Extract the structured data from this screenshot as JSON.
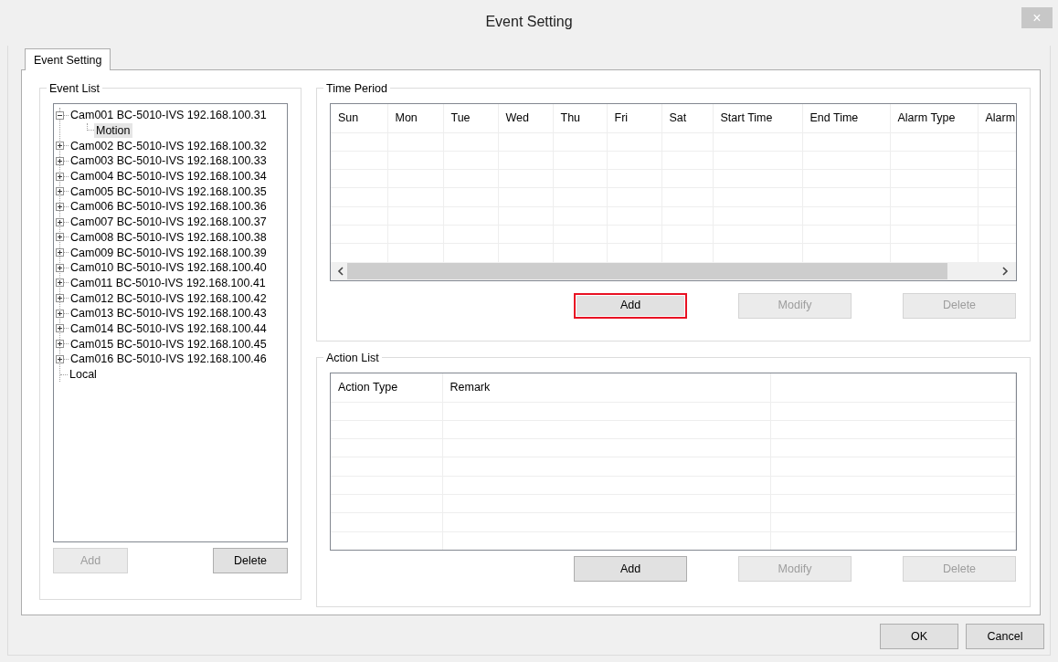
{
  "window": {
    "title": "Event Setting",
    "close": "×"
  },
  "tabs": [
    {
      "label": "Event Setting",
      "selected": true
    }
  ],
  "event_list": {
    "title": "Event List",
    "tree": [
      {
        "label": "Cam001 BC-5010-IVS 192.168.100.31",
        "kind": "group",
        "expanded": true,
        "selected": false,
        "children": [
          {
            "label": "Motion",
            "kind": "leaf",
            "selected": true
          }
        ]
      },
      {
        "label": "Cam002 BC-5010-IVS 192.168.100.32",
        "kind": "group",
        "expanded": false,
        "selected": false
      },
      {
        "label": "Cam003 BC-5010-IVS 192.168.100.33",
        "kind": "group",
        "expanded": false,
        "selected": false
      },
      {
        "label": "Cam004 BC-5010-IVS 192.168.100.34",
        "kind": "group",
        "expanded": false,
        "selected": false
      },
      {
        "label": "Cam005 BC-5010-IVS 192.168.100.35",
        "kind": "group",
        "expanded": false,
        "selected": false
      },
      {
        "label": "Cam006 BC-5010-IVS 192.168.100.36",
        "kind": "group",
        "expanded": false,
        "selected": false
      },
      {
        "label": "Cam007 BC-5010-IVS 192.168.100.37",
        "kind": "group",
        "expanded": false,
        "selected": false
      },
      {
        "label": "Cam008 BC-5010-IVS 192.168.100.38",
        "kind": "group",
        "expanded": false,
        "selected": false
      },
      {
        "label": "Cam009 BC-5010-IVS 192.168.100.39",
        "kind": "group",
        "expanded": false,
        "selected": false
      },
      {
        "label": "Cam010 BC-5010-IVS 192.168.100.40",
        "kind": "group",
        "expanded": false,
        "selected": false
      },
      {
        "label": "Cam011 BC-5010-IVS 192.168.100.41",
        "kind": "group",
        "expanded": false,
        "selected": false
      },
      {
        "label": "Cam012 BC-5010-IVS 192.168.100.42",
        "kind": "group",
        "expanded": false,
        "selected": false
      },
      {
        "label": "Cam013 BC-5010-IVS 192.168.100.43",
        "kind": "group",
        "expanded": false,
        "selected": false
      },
      {
        "label": "Cam014 BC-5010-IVS 192.168.100.44",
        "kind": "group",
        "expanded": false,
        "selected": false
      },
      {
        "label": "Cam015 BC-5010-IVS 192.168.100.45",
        "kind": "group",
        "expanded": false,
        "selected": false
      },
      {
        "label": "Cam016 BC-5010-IVS 192.168.100.46",
        "kind": "group",
        "expanded": false,
        "selected": false
      },
      {
        "label": "Local",
        "kind": "leaf",
        "selected": false
      }
    ],
    "buttons": [
      {
        "label": "Add",
        "disabled": true,
        "highlighted": false
      },
      {
        "label": "Delete",
        "disabled": false,
        "highlighted": false
      }
    ]
  },
  "time_period": {
    "title": "Time Period",
    "table": {
      "columns": [
        "Sun",
        "Mon",
        "Tue",
        "Wed",
        "Thu",
        "Fri",
        "Sat",
        "Start Time",
        "End Time",
        "Alarm Type",
        "Alarm"
      ]
    },
    "buttons": [
      {
        "label": "Add",
        "disabled": false,
        "highlighted": true
      },
      {
        "label": "Modify",
        "disabled": true,
        "highlighted": false
      },
      {
        "label": "Delete",
        "disabled": true,
        "highlighted": false
      }
    ]
  },
  "action_list": {
    "title": "Action List",
    "table": {
      "columns": [
        "Action Type",
        "Remark"
      ]
    },
    "buttons": [
      {
        "label": "Add",
        "disabled": false,
        "highlighted": false
      },
      {
        "label": "Modify",
        "disabled": true,
        "highlighted": false
      },
      {
        "label": "Delete",
        "disabled": true,
        "highlighted": false
      }
    ]
  },
  "footer_buttons": [
    {
      "label": "OK",
      "disabled": false,
      "highlighted": false
    },
    {
      "label": "Cancel",
      "disabled": false,
      "highlighted": false
    }
  ]
}
